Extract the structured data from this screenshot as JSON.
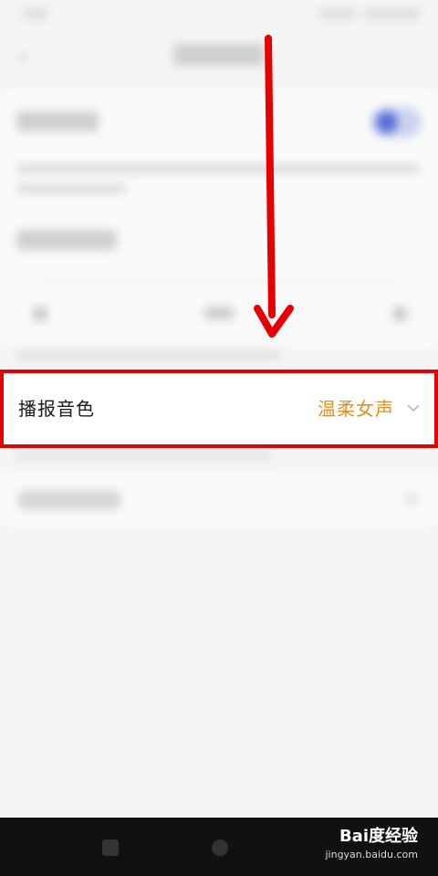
{
  "setting": {
    "label": "播报音色",
    "value": "温柔女声",
    "chevron_icon": "chevron-down-icon",
    "value_color": "#e58f1a",
    "highlight_color": "#e60000"
  },
  "annotation": {
    "arrow_color": "#e60000"
  },
  "watermark": {
    "brand": "Bai度经验",
    "url": "jingyan.baidu.com"
  }
}
